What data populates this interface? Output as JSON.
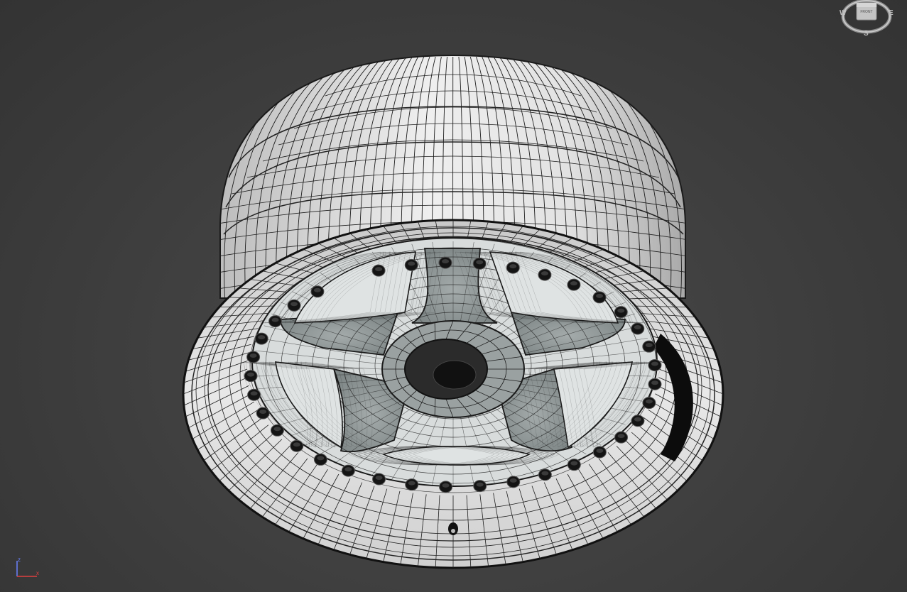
{
  "viewcube": {
    "west": "W",
    "east": "E",
    "south": "S",
    "face": "FRONT"
  },
  "axis_tripod": {
    "z": "z",
    "x": "x"
  },
  "colors": {
    "viewport_background": "#404040",
    "mesh_fill": "#e4e4e4",
    "wire": "#1a1a1a",
    "face_fill": "#8f9797",
    "hub_fill": "#2b2b2b",
    "axis_x": "#e04040",
    "axis_z": "#6a82ff"
  },
  "model": {
    "object": "wheel-rim",
    "spoke_count": 5,
    "rim_bolt_count": 36,
    "display_mode": "shaded-with-wireframe"
  }
}
